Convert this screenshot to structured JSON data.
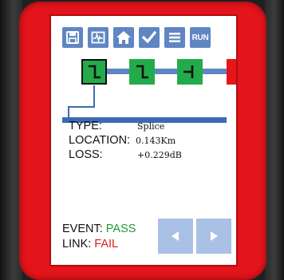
{
  "toolbar": {
    "buttons": [
      {
        "name": "save",
        "icon": "save-icon"
      },
      {
        "name": "trace",
        "icon": "waveform-icon"
      },
      {
        "name": "home",
        "icon": "home-icon"
      },
      {
        "name": "check",
        "icon": "checkmark-icon"
      },
      {
        "name": "menu",
        "icon": "menu-icon"
      },
      {
        "name": "run",
        "label": "RUN"
      }
    ]
  },
  "link_map": {
    "events": [
      {
        "type": "splice",
        "icon": "splice-event-icon",
        "status": "pass",
        "selected": true
      },
      {
        "type": "splice",
        "icon": "splice-event-icon",
        "status": "pass",
        "selected": false
      },
      {
        "type": "connector",
        "icon": "connector-event-icon",
        "status": "pass",
        "selected": false
      },
      {
        "type": "end",
        "status": "fail",
        "selected": false
      }
    ],
    "colors": {
      "pass": "#23ab4b",
      "fail": "#e41619",
      "fiber": "#5f86c3"
    }
  },
  "event_info": {
    "type_label": "TYPE:",
    "type_value": "Splice",
    "location_label": "LOCATION:",
    "location_value": "0.143Km",
    "loss_label": "LOSS:",
    "loss_value": "+0.229dB"
  },
  "status": {
    "event_label": "EVENT:",
    "event_value": "PASS",
    "link_label": "LINK:",
    "link_value": "FAIL"
  },
  "navigation": {
    "prev_icon": "triangle-left-icon",
    "next_icon": "triangle-right-icon"
  }
}
